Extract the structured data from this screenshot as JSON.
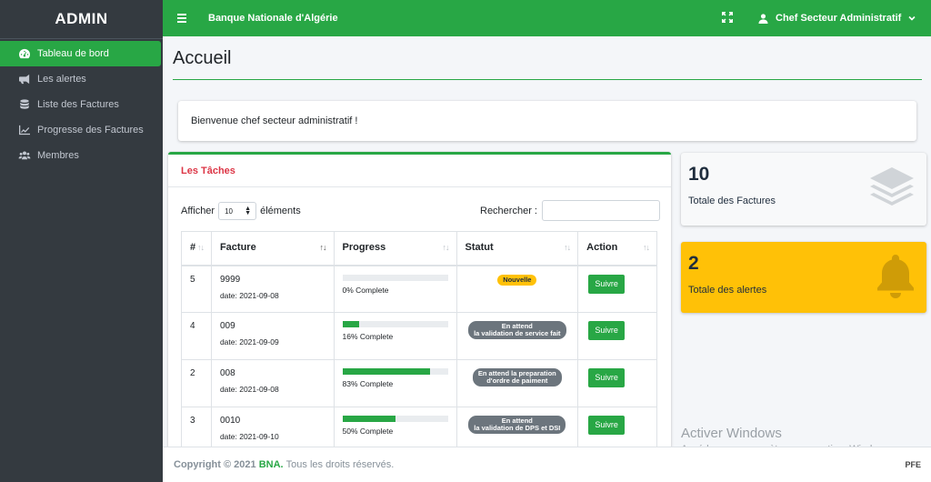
{
  "sidebar": {
    "brand": "ADMIN",
    "items": [
      {
        "label": "Tableau de bord",
        "icon": "dashboard-icon",
        "active": true
      },
      {
        "label": "Les alertes",
        "icon": "bullhorn-icon"
      },
      {
        "label": "Liste des Factures",
        "icon": "database-icon"
      },
      {
        "label": "Progresse des Factures",
        "icon": "chart-line-icon"
      },
      {
        "label": "Membres",
        "icon": "users-icon"
      }
    ]
  },
  "topbar": {
    "bank": "Banque Nationale d'Algérie",
    "user": "Chef Secteur Administratif"
  },
  "page": {
    "title": "Accueil",
    "welcome": "Bienvenue chef secteur administratif !"
  },
  "tasks": {
    "title": "Les Tâches",
    "show_before": "Afficher",
    "show_value": "10",
    "show_after": "éléments",
    "search_label": "Rechercher :",
    "columns": [
      "#",
      "Facture",
      "Progress",
      "Statut",
      "Action"
    ],
    "rows": [
      {
        "num": "5",
        "facture": "9999",
        "date": "date: 2021-09-08",
        "progress_pct": 0,
        "progress_label": "0% Complete",
        "status": "Nouvelle",
        "status_style": "new",
        "action": "Suivre"
      },
      {
        "num": "4",
        "facture": "009",
        "date": "date: 2021-09-09",
        "progress_pct": 16,
        "progress_label": "16% Complete",
        "status": "En attend\nla validation de service fait",
        "status_style": "gray",
        "action": "Suivre"
      },
      {
        "num": "2",
        "facture": "008",
        "date": "date: 2021-09-08",
        "progress_pct": 83,
        "progress_label": "83% Complete",
        "status": "En attend la preparation\nd'ordre de paiment",
        "status_style": "gray",
        "action": "Suivre"
      },
      {
        "num": "3",
        "facture": "0010",
        "date": "date: 2021-09-10",
        "progress_pct": 50,
        "progress_label": "50% Complete",
        "status": "En attend\nla validation de DPS et DSI",
        "status_style": "gray",
        "action": "Suivre"
      }
    ]
  },
  "stats": {
    "factures_value": "10",
    "factures_label": "Totale des Factures",
    "alertes_value": "2",
    "alertes_label": "Totale des alertes"
  },
  "watermark": {
    "line1": "Activer Windows",
    "line2": "Accédez aux paramètres pour activer Windows."
  },
  "footer": {
    "copyright": "Copyright © 2021",
    "brand": "BNA.",
    "rights": "Tous les droits réservés.",
    "right": "PFE"
  },
  "colors": {
    "accent": "#28a745",
    "sidebar": "#343a40",
    "warning": "#ffc107",
    "danger": "#dc3545"
  }
}
